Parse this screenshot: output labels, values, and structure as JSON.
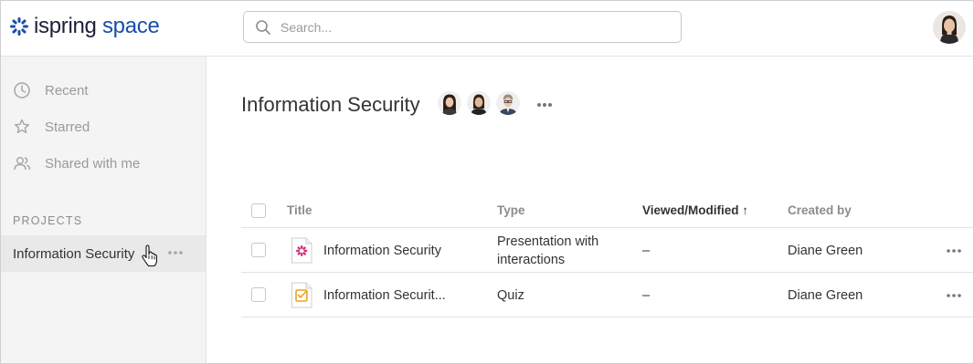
{
  "app": {
    "logo_text_1": "ispring",
    "logo_text_2": "space"
  },
  "search": {
    "placeholder": "Search...",
    "value": ""
  },
  "sidebar": {
    "items": [
      {
        "label": "Recent",
        "icon": "clock-icon"
      },
      {
        "label": "Starred",
        "icon": "star-icon"
      },
      {
        "label": "Shared with me",
        "icon": "users-icon"
      }
    ],
    "projects_heading": "PROJECTS",
    "projects": [
      {
        "label": "Information Security"
      }
    ]
  },
  "main": {
    "title": "Information Security",
    "table": {
      "headers": {
        "title": "Title",
        "type": "Type",
        "viewed": "Viewed/Modified",
        "viewed_sort": "↑",
        "created_by": "Created by"
      },
      "rows": [
        {
          "title": "Information Security",
          "type_line1": "Presentation with",
          "type_line2": "interactions",
          "viewed": "–",
          "created_by": "Diane Green",
          "icon": "presentation-icon"
        },
        {
          "title": "Information Securit...",
          "type_line1": "Quiz",
          "type_line2": "",
          "viewed": "–",
          "created_by": "Diane Green",
          "icon": "quiz-icon"
        }
      ]
    }
  },
  "colors": {
    "brand_dark": "#1b1f3b",
    "brand_blue": "#1a4fa8",
    "presentation_pink": "#d6307a",
    "quiz_orange": "#f0a020",
    "sidebar_bg": "#f4f4f4",
    "active_item_bg": "#e9e9e9"
  }
}
